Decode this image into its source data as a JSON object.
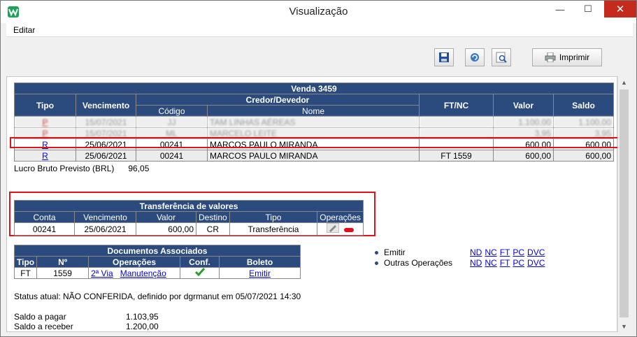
{
  "window": {
    "title": "Visualização",
    "minimize": "—",
    "maximize": "☐",
    "close": "✕"
  },
  "menu": {
    "editar": "Editar"
  },
  "toolbar": {
    "print_label": "Imprimir"
  },
  "venda": {
    "title": "Venda  3459",
    "headers": {
      "tipo": "Tipo",
      "vencimento": "Vencimento",
      "credor": "Credor/Devedor",
      "codigo": "Código",
      "nome": "Nome",
      "ftnc": "FT/NC",
      "valor": "Valor",
      "saldo": "Saldo"
    },
    "rows": [
      {
        "tipo": "P",
        "vencimento": "15/07/2021",
        "codigo": "JJ",
        "nome": "TAM LINHAS AÉREAS",
        "ftnc": "",
        "valor": "1.100,00",
        "saldo": "1.100,00"
      },
      {
        "tipo": "P",
        "vencimento": "15/07/2021",
        "codigo": "ML",
        "nome": "MARCELO LEITE",
        "ftnc": "",
        "valor": "3,95",
        "saldo": "3,95"
      },
      {
        "tipo": "R",
        "vencimento": "25/06/2021",
        "codigo": "00241",
        "nome": "MARCOS PAULO MIRANDA",
        "ftnc": "",
        "valor": "600,00",
        "saldo": "600,00"
      },
      {
        "tipo": "R",
        "vencimento": "25/06/2021",
        "codigo": "00241",
        "nome": "MARCOS PAULO MIRANDA",
        "ftnc": "FT 1559",
        "valor": "600,00",
        "saldo": "600,00"
      }
    ]
  },
  "lucro": {
    "label": "Lucro Bruto Previsto (BRL)",
    "value": "96,05"
  },
  "transferencia": {
    "title": "Transferência de valores",
    "headers": {
      "conta": "Conta",
      "vencimento": "Vencimento",
      "valor": "Valor",
      "destino": "Destino",
      "tipo": "Tipo",
      "operacoes": "Operações"
    },
    "row": {
      "conta": "00241",
      "vencimento": "25/06/2021",
      "valor": "600,00",
      "destino": "CR",
      "tipo": "Transferência"
    }
  },
  "documentos": {
    "title": "Documentos Associados",
    "headers": {
      "tipo": "Tipo",
      "numero": "Nº",
      "operacoes": "Operações",
      "conf": "Conf.",
      "boleto": "Boleto"
    },
    "row": {
      "tipo": "FT",
      "numero": "1559",
      "via": "2ª Via",
      "manutencao": "Manutenção",
      "boleto": "Emitir"
    }
  },
  "emitir": {
    "emitir_label": "Emitir",
    "outras_label": "Outras Operações",
    "links": [
      "ND",
      "NC",
      "FT",
      "PC",
      "DVC"
    ]
  },
  "status": {
    "text": "Status atual: NÃO CONFERIDA, definido por dgrmanut em 05/07/2021 14:30"
  },
  "saldos": {
    "pagar_label": "Saldo a pagar",
    "pagar_value": "1.103,95",
    "receber_label": "Saldo a receber",
    "receber_value": "1.200,00"
  }
}
